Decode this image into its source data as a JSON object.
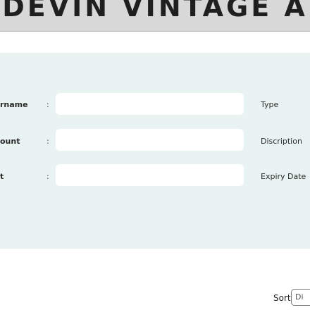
{
  "header": {
    "title": "DEVIN VINTAGE A"
  },
  "form": {
    "rows": [
      {
        "label": "rname",
        "colon": ":",
        "value": "",
        "side_label": "Type"
      },
      {
        "label": "ount",
        "colon": ":",
        "value": "",
        "side_label": "Discription"
      },
      {
        "label": "t",
        "colon": ":",
        "value": "",
        "side_label": "Expiry Date"
      }
    ]
  },
  "sort": {
    "label": "Sort",
    "selected": "Di"
  },
  "colors": {
    "header_bg": "#d8d8d8",
    "panel_bg": "#e9f4f2",
    "field_bg": "#ffffff"
  }
}
